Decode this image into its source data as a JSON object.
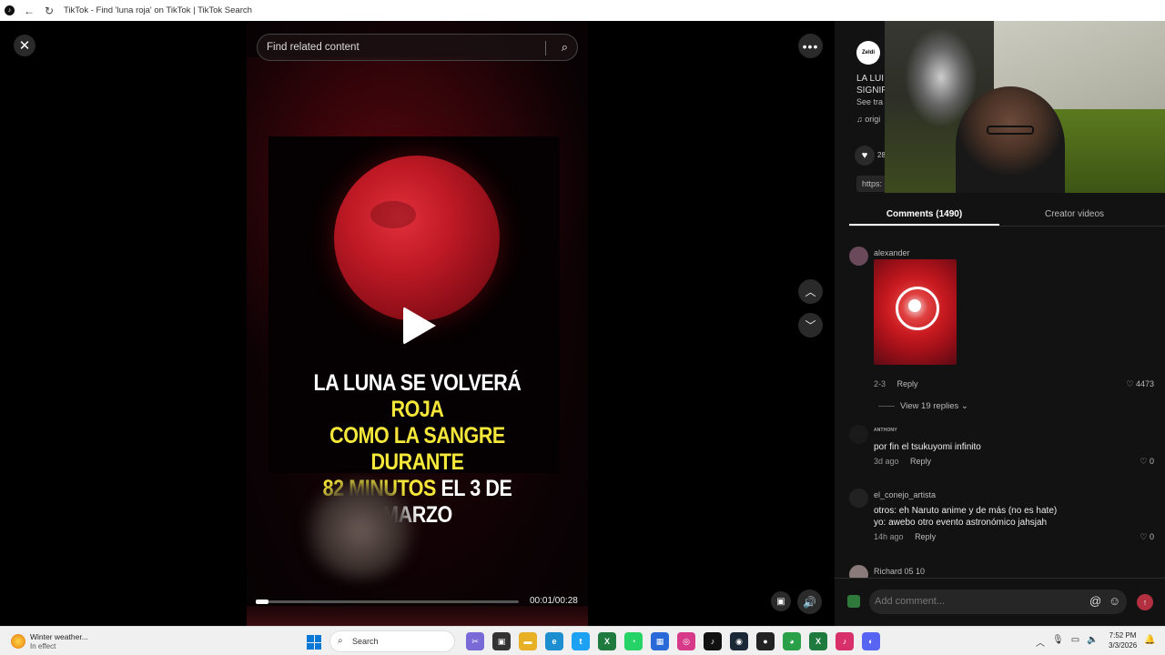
{
  "browser": {
    "tab_title": "TikTok - Find 'luna roja' on TikTok | TikTok Search",
    "back_icon": "←",
    "forward_icon": "→",
    "reload_icon": "↻"
  },
  "video": {
    "search_placeholder": "Find related content",
    "caption_lines": [
      [
        {
          "t": "LA LUNA SE VOLVERÁ ",
          "c": "w"
        },
        {
          "t": "ROJA",
          "c": "y"
        }
      ],
      [
        {
          "t": "COMO LA SANGRE DURANTE",
          "c": "y"
        }
      ],
      [
        {
          "t": "82 MINUTOS",
          "c": "y"
        },
        {
          "t": " EL 3 DE MARZO",
          "c": "w"
        }
      ]
    ],
    "time": "00:01/00:28",
    "progress": 0.05
  },
  "panel": {
    "author_avatar_text": "Zeldi",
    "desc_lines": [
      "LA LUI",
      "SIGNIF",
      "See tra"
    ],
    "music": "♫ origi",
    "like_count": "28",
    "link_text": "https:",
    "tabs": [
      {
        "label": "Comments (1490)",
        "active": true
      },
      {
        "label": "Creator videos",
        "active": false
      }
    ],
    "comments": [
      {
        "user": "alexander",
        "text": "",
        "time": "2-3",
        "reply": "Reply",
        "likes": "4473",
        "has_sticker": true,
        "view_replies": "View 19 replies"
      },
      {
        "user": "ᴀɴᴛʜᴏɴʏ",
        "text": "por fin el tsukuyomi infinito",
        "time": "3d ago",
        "reply": "Reply",
        "likes": "0"
      },
      {
        "user": "el_conejo_artista",
        "text": "otros: eh Naruto anime y de más (no es hate)",
        "text2": "yo: awebo otro evento astronómico jahsjah",
        "time": "14h ago",
        "reply": "Reply",
        "likes": "0"
      },
      {
        "user": "Richard 05 10"
      }
    ],
    "add_comment_placeholder": "Add comment..."
  },
  "taskbar": {
    "weather_title": "Winter weather...",
    "weather_sub": "In effect",
    "search_label": "Search",
    "time": "7:52 PM",
    "date": "3/3/2026",
    "apps": [
      {
        "name": "snipping-icon",
        "color": "#7a6ad8",
        "glyph": "✂"
      },
      {
        "name": "task-view-icon",
        "color": "#333",
        "glyph": "▣"
      },
      {
        "name": "file-explorer-icon",
        "color": "#e8b024",
        "glyph": "▬"
      },
      {
        "name": "edge-icon",
        "color": "#1d8fd0",
        "glyph": "e"
      },
      {
        "name": "twitter-icon",
        "color": "#1da1f2",
        "glyph": "t"
      },
      {
        "name": "excel-icon",
        "color": "#1f7a3e",
        "glyph": "X"
      },
      {
        "name": "whatsapp-icon",
        "color": "#25d366",
        "glyph": "◔"
      },
      {
        "name": "store-icon",
        "color": "#2a6ad8",
        "glyph": "▦"
      },
      {
        "name": "instagram-icon",
        "color": "#d83a8a",
        "glyph": "◎"
      },
      {
        "name": "tiktok-icon",
        "color": "#111",
        "glyph": "♪"
      },
      {
        "name": "steam-icon",
        "color": "#1b2838",
        "glyph": "◉"
      },
      {
        "name": "obs-icon",
        "color": "#222",
        "glyph": "●"
      },
      {
        "name": "chrome-icon",
        "color": "#2aa048",
        "glyph": "◕"
      },
      {
        "name": "excel2-icon",
        "color": "#1f7a3e",
        "glyph": "X"
      },
      {
        "name": "app-icon",
        "color": "#d8306a",
        "glyph": "♪"
      },
      {
        "name": "discord-icon",
        "color": "#5865f2",
        "glyph": "◐"
      }
    ]
  }
}
